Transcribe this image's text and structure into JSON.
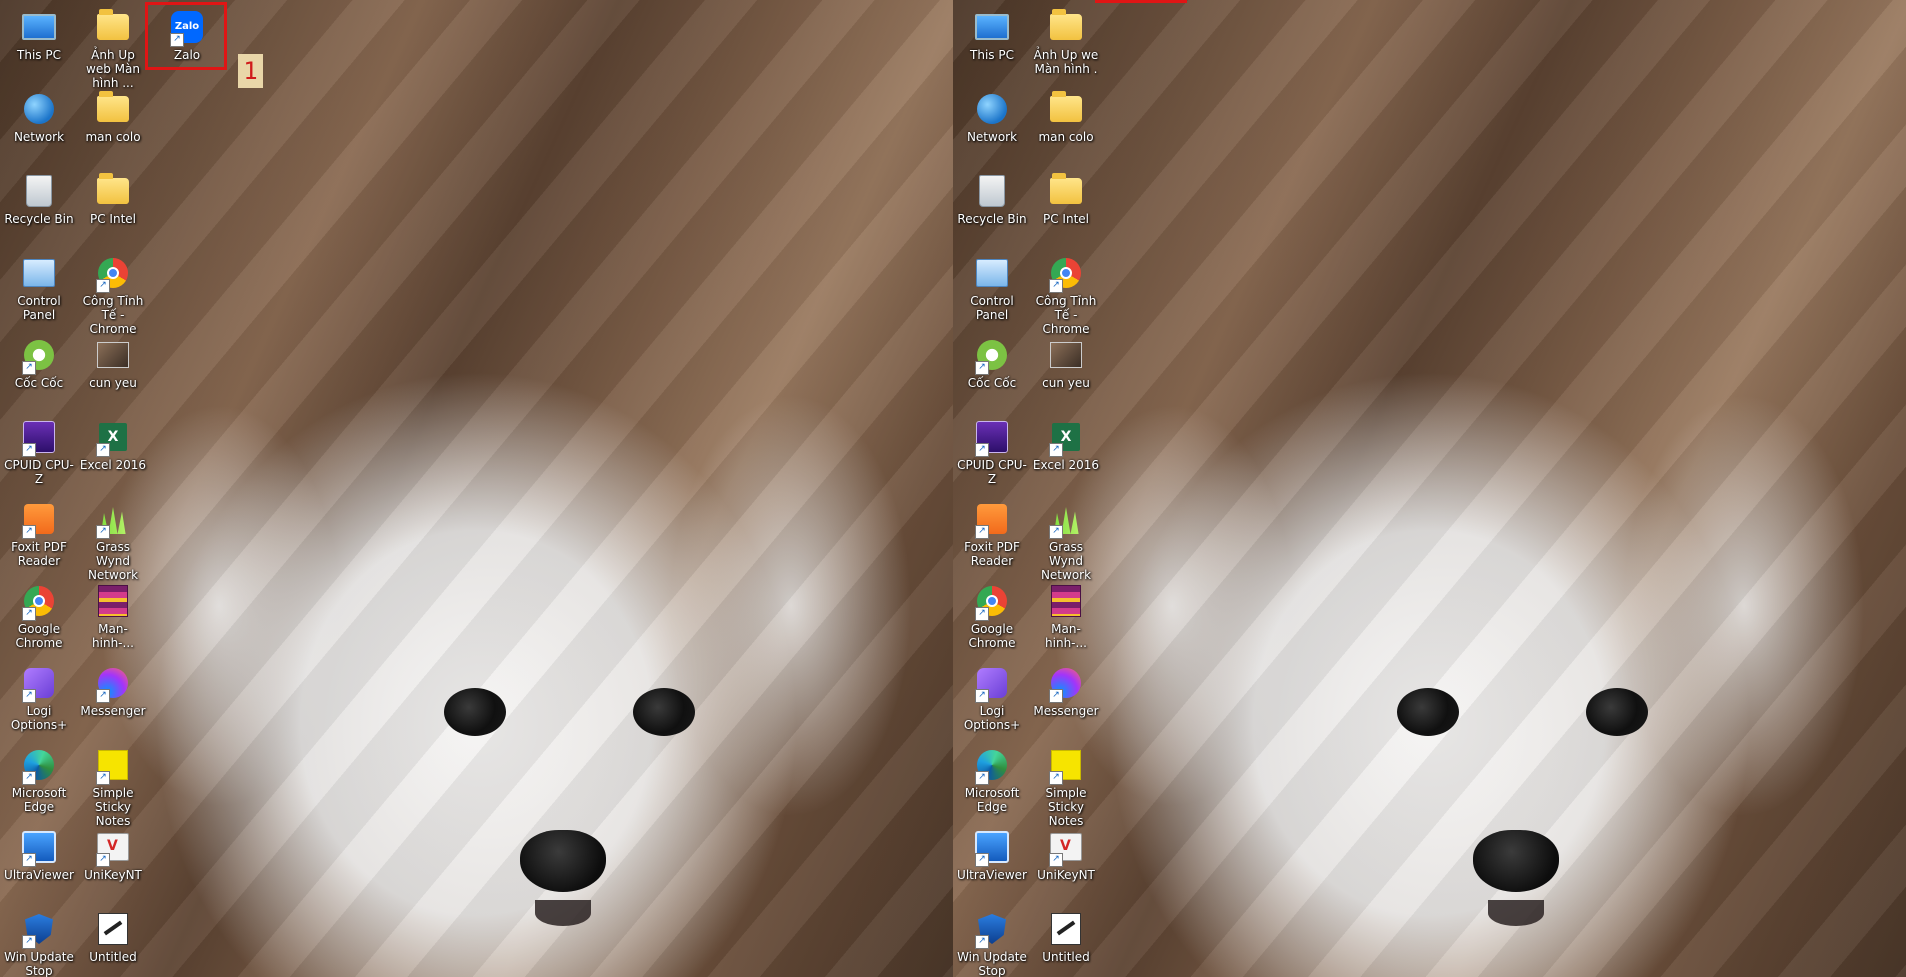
{
  "left_screen": {
    "icons": [
      {
        "label": "This PC",
        "icon": "this-pc-icon",
        "type": "pc"
      },
      {
        "label": "Ảnh Up web Màn hình ...",
        "icon": "folder-icon",
        "type": "folder"
      },
      {
        "label": "Zalo",
        "icon": "zalo-icon",
        "type": "zalo"
      },
      {
        "label": "Network",
        "icon": "network-icon",
        "type": "globe"
      },
      {
        "label": "man colo",
        "icon": "folder-icon",
        "type": "folder"
      },
      {
        "label": "Recycle Bin",
        "icon": "recycle-bin-icon",
        "type": "bin"
      },
      {
        "label": "PC Intel",
        "icon": "folder-icon",
        "type": "folder"
      },
      {
        "label": "Control Panel",
        "icon": "control-panel-icon",
        "type": "panel"
      },
      {
        "label": "Công Tỉnh Tế - Chrome",
        "icon": "chrome-icon",
        "type": "chrome"
      },
      {
        "label": "Cốc Cốc",
        "icon": "coccoc-icon",
        "type": "coccoc"
      },
      {
        "label": "cun yeu",
        "icon": "photo-icon",
        "type": "photo"
      },
      {
        "label": "CPUID CPU-Z",
        "icon": "cpuz-icon",
        "type": "cpuz"
      },
      {
        "label": "Excel 2016",
        "icon": "excel-icon",
        "type": "excel"
      },
      {
        "label": "Foxit PDF Reader",
        "icon": "foxit-icon",
        "type": "foxit"
      },
      {
        "label": "Grass Wynd Network",
        "icon": "grass-icon",
        "type": "grass"
      },
      {
        "label": "Google Chrome",
        "icon": "chrome-icon",
        "type": "chrome"
      },
      {
        "label": "Man-hinh-...",
        "icon": "winrar-icon",
        "type": "rar"
      },
      {
        "label": "Logi Options+",
        "icon": "logi-icon",
        "type": "logi"
      },
      {
        "label": "Messenger",
        "icon": "messenger-icon",
        "type": "msgr"
      },
      {
        "label": "Microsoft Edge",
        "icon": "edge-icon",
        "type": "edge"
      },
      {
        "label": "Simple Sticky Notes",
        "icon": "sticky-notes-icon",
        "type": "sticky"
      },
      {
        "label": "UltraViewer",
        "icon": "ultraviewer-icon",
        "type": "ultra"
      },
      {
        "label": "UniKeyNT",
        "icon": "unikey-icon",
        "type": "unikey"
      },
      {
        "label": "Win Update Stop",
        "icon": "shield-icon",
        "type": "shield"
      },
      {
        "label": "Untitled",
        "icon": "untitled-icon",
        "type": "untitled"
      }
    ]
  },
  "right_screen": {
    "icons": [
      {
        "label": "This PC",
        "icon": "this-pc-icon",
        "type": "pc"
      },
      {
        "label": "Ảnh Up we Màn hình .",
        "icon": "folder-icon",
        "type": "folder"
      },
      {
        "label": "Network",
        "icon": "network-icon",
        "type": "globe"
      },
      {
        "label": "man colo",
        "icon": "folder-icon",
        "type": "folder"
      },
      {
        "label": "Recycle Bin",
        "icon": "recycle-bin-icon",
        "type": "bin"
      },
      {
        "label": "PC Intel",
        "icon": "folder-icon",
        "type": "folder"
      },
      {
        "label": "Control Panel",
        "icon": "control-panel-icon",
        "type": "panel"
      },
      {
        "label": "Công Tỉnh Tế - Chrome",
        "icon": "chrome-icon",
        "type": "chrome"
      },
      {
        "label": "Cốc Cốc",
        "icon": "coccoc-icon",
        "type": "coccoc"
      },
      {
        "label": "cun yeu",
        "icon": "photo-icon",
        "type": "photo"
      },
      {
        "label": "CPUID CPU-Z",
        "icon": "cpuz-icon",
        "type": "cpuz"
      },
      {
        "label": "Excel 2016",
        "icon": "excel-icon",
        "type": "excel"
      },
      {
        "label": "Foxit PDF Reader",
        "icon": "foxit-icon",
        "type": "foxit"
      },
      {
        "label": "Grass Wynd Network",
        "icon": "grass-icon",
        "type": "grass"
      },
      {
        "label": "Google Chrome",
        "icon": "chrome-icon",
        "type": "chrome"
      },
      {
        "label": "Man-hinh-...",
        "icon": "winrar-icon",
        "type": "rar"
      },
      {
        "label": "Logi Options+",
        "icon": "logi-icon",
        "type": "logi"
      },
      {
        "label": "Messenger",
        "icon": "messenger-icon",
        "type": "msgr"
      },
      {
        "label": "Microsoft Edge",
        "icon": "edge-icon",
        "type": "edge"
      },
      {
        "label": "Simple Sticky Notes",
        "icon": "sticky-notes-icon",
        "type": "sticky"
      },
      {
        "label": "UltraViewer",
        "icon": "ultraviewer-icon",
        "type": "ultra"
      },
      {
        "label": "UniKeyNT",
        "icon": "unikey-icon",
        "type": "unikey"
      },
      {
        "label": "Win Update Stop",
        "icon": "shield-icon",
        "type": "shield"
      },
      {
        "label": "Untitled",
        "icon": "untitled-icon",
        "type": "untitled"
      }
    ]
  },
  "annotation": {
    "step_number": "1",
    "highlight_color": "#e01515",
    "badge_color": "#e9d6a8"
  }
}
